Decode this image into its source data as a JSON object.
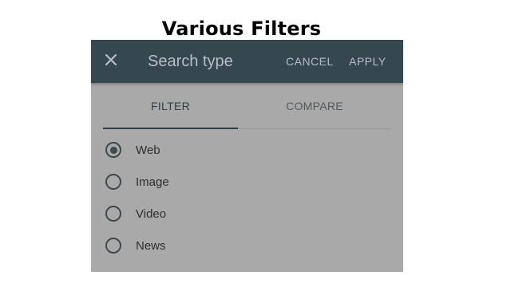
{
  "slide": {
    "title": "Various Filters"
  },
  "appbar": {
    "close_icon": "close-icon",
    "title": "Search type",
    "cancel_label": "CANCEL",
    "apply_label": "APPLY",
    "background": "#35474f"
  },
  "tabs": [
    {
      "label": "FILTER",
      "selected": true
    },
    {
      "label": "COMPARE",
      "selected": false
    }
  ],
  "options": [
    {
      "label": "Web",
      "selected": true
    },
    {
      "label": "Image",
      "selected": false
    },
    {
      "label": "Video",
      "selected": false
    },
    {
      "label": "News",
      "selected": false
    }
  ],
  "colors": {
    "dialog_background": "#a9a9a9",
    "text_muted": "#b7bfc3"
  }
}
